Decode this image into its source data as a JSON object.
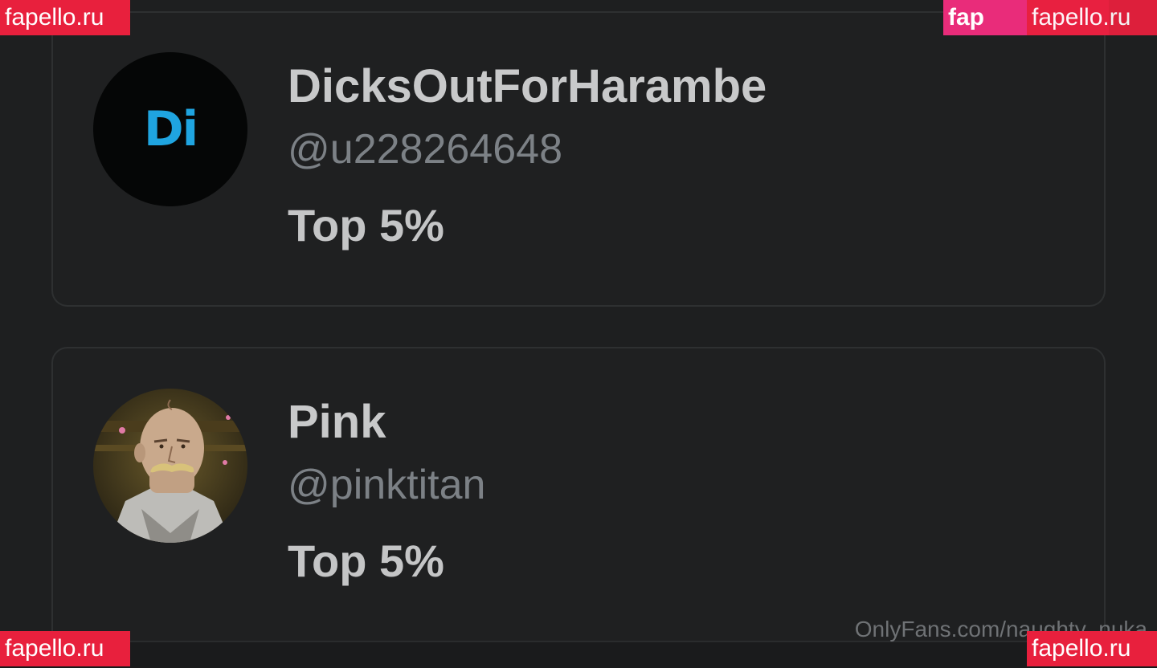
{
  "watermark": "fapello.ru",
  "watermark_back": "fap",
  "source_watermark": "OnlyFans.com/naughty_nuka",
  "colors": {
    "background": "#1e1f20",
    "card_border": "#2e3031",
    "name_text": "#c8c9ca",
    "handle_text": "#7c8186",
    "initials": "#1fa4e0",
    "watermark_bg": "#e8203d"
  },
  "subscribers": [
    {
      "name": "DicksOutForHarambe",
      "handle": "@u228264648",
      "rank": "Top 5%",
      "avatar_initials": "Di"
    },
    {
      "name": "Pink",
      "handle": "@pinktitan",
      "rank": "Top 5%",
      "avatar_icon": "cartoon-portrait"
    }
  ]
}
